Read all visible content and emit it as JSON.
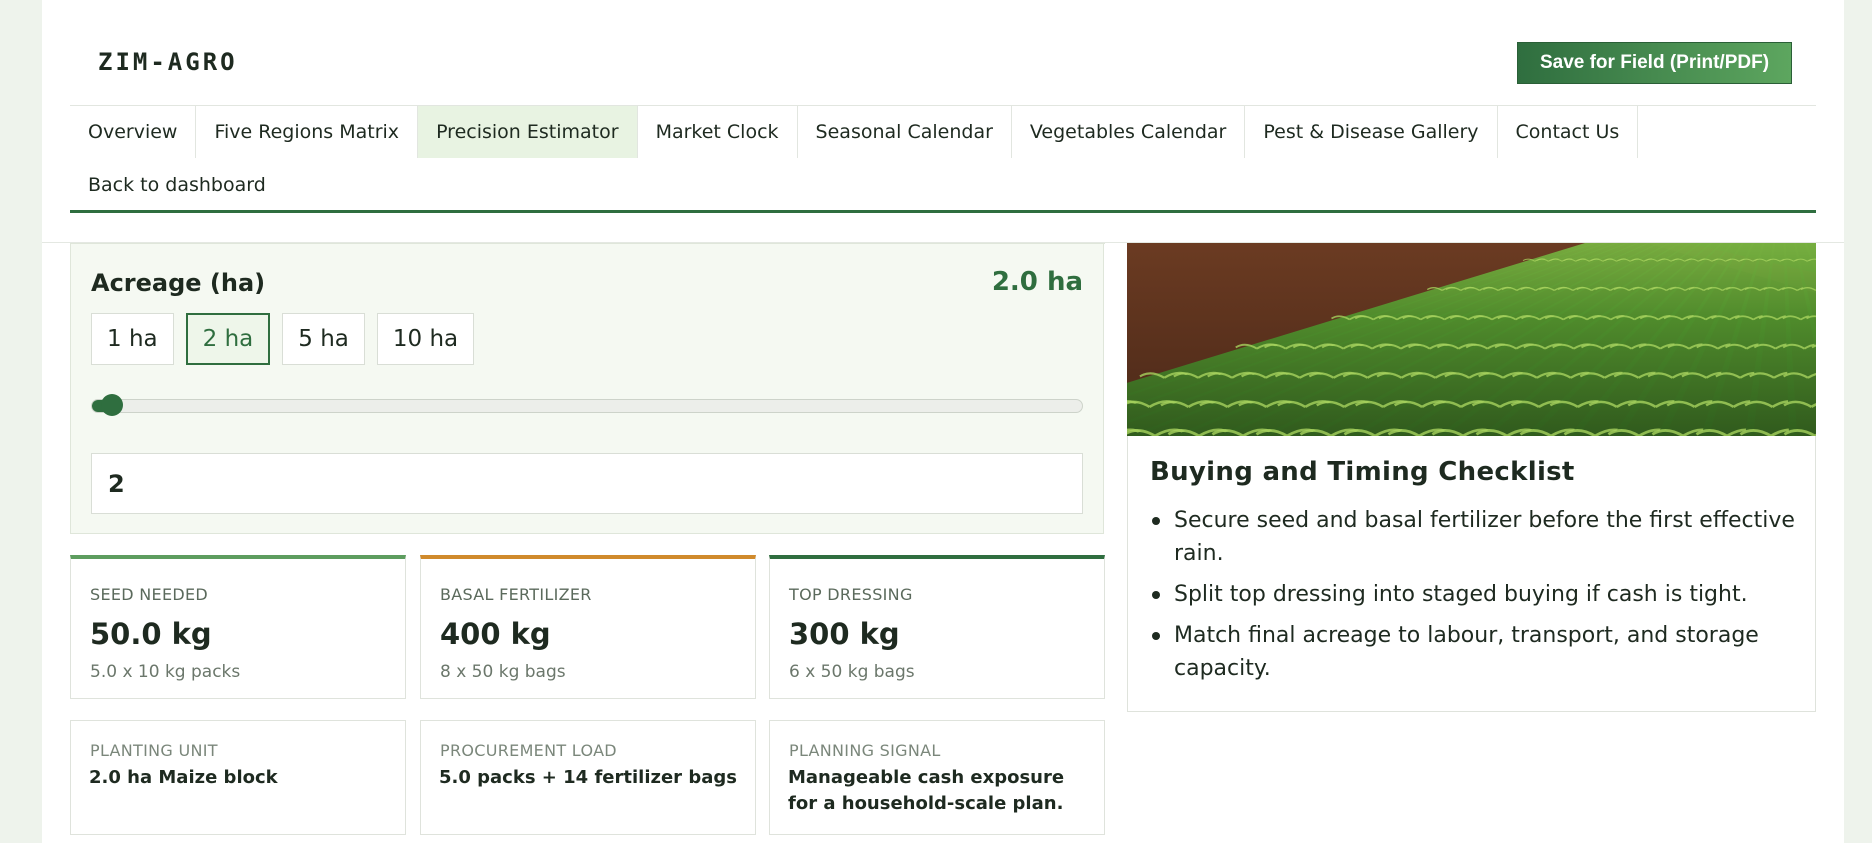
{
  "brand": "ZIM-AGRO",
  "save_label": "Save for Field (Print/PDF)",
  "nav": {
    "tabs": [
      {
        "label": "Overview"
      },
      {
        "label": "Five Regions Matrix"
      },
      {
        "label": "Precision Estimator"
      },
      {
        "label": "Market Clock"
      },
      {
        "label": "Seasonal Calendar"
      },
      {
        "label": "Vegetables Calendar"
      },
      {
        "label": "Pest & Disease Gallery"
      },
      {
        "label": "Contact Us"
      }
    ],
    "active_tab": "Precision Estimator",
    "back_link": "Back to dashboard"
  },
  "acreage": {
    "label": "Acreage (ha)",
    "display_value": "2.0 ha",
    "chips": [
      "1 ha",
      "2 ha",
      "5 ha",
      "10 ha"
    ],
    "selected_chip": "2 ha",
    "input_value": "2",
    "slider_min": 0,
    "slider_max": 100,
    "slider_value": 2
  },
  "stats": [
    {
      "kicker": "SEED NEEDED",
      "amount": "50.0 kg",
      "sub": "5.0 x 10 kg packs",
      "accent": "#5d9d5f"
    },
    {
      "kicker": "BASAL FERTILIZER",
      "amount": "400 kg",
      "sub": "8 x 50 kg bags",
      "accent": "#d08a2c"
    },
    {
      "kicker": "TOP DRESSING",
      "amount": "300 kg",
      "sub": "6 x 50 kg bags",
      "accent": "#2f6e3f"
    }
  ],
  "summary": [
    {
      "kicker": "PLANTING UNIT",
      "detail": "2.0 ha Maize block"
    },
    {
      "kicker": "PROCUREMENT LOAD",
      "detail": "5.0 packs + 14 fertilizer bags"
    },
    {
      "kicker": "PLANNING SIGNAL",
      "detail": "Manageable cash exposure for a household-scale plan."
    }
  ],
  "checklist": {
    "title": "Buying and Timing Checklist",
    "items": [
      "Secure seed and basal fertilizer before the first effective rain.",
      "Split top dressing into staged buying if cash is tight.",
      "Match final acreage to labour, transport, and storage capacity."
    ]
  },
  "colors": {
    "brand_green": "#2f6e3f",
    "accent_orange": "#d08a2c",
    "active_tab_bg": "#e8f3e2"
  },
  "icons": {
    "photo": "maize-field-photo"
  }
}
